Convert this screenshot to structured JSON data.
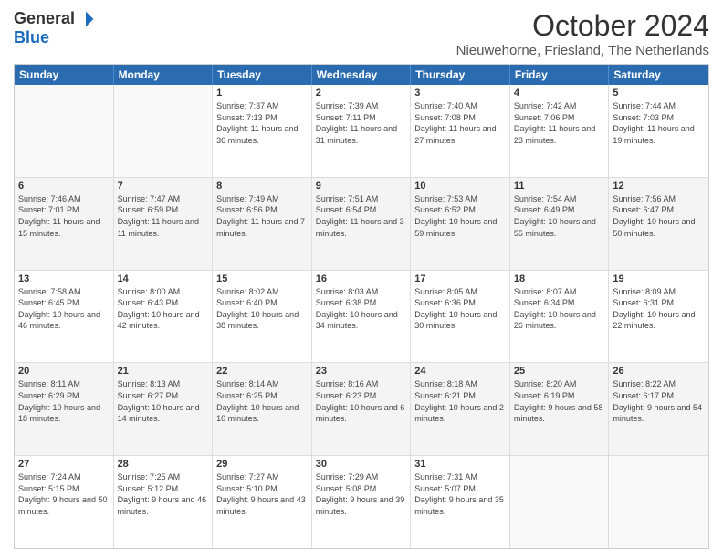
{
  "logo": {
    "general": "General",
    "blue": "Blue"
  },
  "title": "October 2024",
  "location": "Nieuwehorne, Friesland, The Netherlands",
  "days": [
    "Sunday",
    "Monday",
    "Tuesday",
    "Wednesday",
    "Thursday",
    "Friday",
    "Saturday"
  ],
  "weeks": [
    [
      {
        "date": "",
        "sunrise": "",
        "sunset": "",
        "daylight": ""
      },
      {
        "date": "",
        "sunrise": "",
        "sunset": "",
        "daylight": ""
      },
      {
        "date": "1",
        "sunrise": "Sunrise: 7:37 AM",
        "sunset": "Sunset: 7:13 PM",
        "daylight": "Daylight: 11 hours and 36 minutes."
      },
      {
        "date": "2",
        "sunrise": "Sunrise: 7:39 AM",
        "sunset": "Sunset: 7:11 PM",
        "daylight": "Daylight: 11 hours and 31 minutes."
      },
      {
        "date": "3",
        "sunrise": "Sunrise: 7:40 AM",
        "sunset": "Sunset: 7:08 PM",
        "daylight": "Daylight: 11 hours and 27 minutes."
      },
      {
        "date": "4",
        "sunrise": "Sunrise: 7:42 AM",
        "sunset": "Sunset: 7:06 PM",
        "daylight": "Daylight: 11 hours and 23 minutes."
      },
      {
        "date": "5",
        "sunrise": "Sunrise: 7:44 AM",
        "sunset": "Sunset: 7:03 PM",
        "daylight": "Daylight: 11 hours and 19 minutes."
      }
    ],
    [
      {
        "date": "6",
        "sunrise": "Sunrise: 7:46 AM",
        "sunset": "Sunset: 7:01 PM",
        "daylight": "Daylight: 11 hours and 15 minutes."
      },
      {
        "date": "7",
        "sunrise": "Sunrise: 7:47 AM",
        "sunset": "Sunset: 6:59 PM",
        "daylight": "Daylight: 11 hours and 11 minutes."
      },
      {
        "date": "8",
        "sunrise": "Sunrise: 7:49 AM",
        "sunset": "Sunset: 6:56 PM",
        "daylight": "Daylight: 11 hours and 7 minutes."
      },
      {
        "date": "9",
        "sunrise": "Sunrise: 7:51 AM",
        "sunset": "Sunset: 6:54 PM",
        "daylight": "Daylight: 11 hours and 3 minutes."
      },
      {
        "date": "10",
        "sunrise": "Sunrise: 7:53 AM",
        "sunset": "Sunset: 6:52 PM",
        "daylight": "Daylight: 10 hours and 59 minutes."
      },
      {
        "date": "11",
        "sunrise": "Sunrise: 7:54 AM",
        "sunset": "Sunset: 6:49 PM",
        "daylight": "Daylight: 10 hours and 55 minutes."
      },
      {
        "date": "12",
        "sunrise": "Sunrise: 7:56 AM",
        "sunset": "Sunset: 6:47 PM",
        "daylight": "Daylight: 10 hours and 50 minutes."
      }
    ],
    [
      {
        "date": "13",
        "sunrise": "Sunrise: 7:58 AM",
        "sunset": "Sunset: 6:45 PM",
        "daylight": "Daylight: 10 hours and 46 minutes."
      },
      {
        "date": "14",
        "sunrise": "Sunrise: 8:00 AM",
        "sunset": "Sunset: 6:43 PM",
        "daylight": "Daylight: 10 hours and 42 minutes."
      },
      {
        "date": "15",
        "sunrise": "Sunrise: 8:02 AM",
        "sunset": "Sunset: 6:40 PM",
        "daylight": "Daylight: 10 hours and 38 minutes."
      },
      {
        "date": "16",
        "sunrise": "Sunrise: 8:03 AM",
        "sunset": "Sunset: 6:38 PM",
        "daylight": "Daylight: 10 hours and 34 minutes."
      },
      {
        "date": "17",
        "sunrise": "Sunrise: 8:05 AM",
        "sunset": "Sunset: 6:36 PM",
        "daylight": "Daylight: 10 hours and 30 minutes."
      },
      {
        "date": "18",
        "sunrise": "Sunrise: 8:07 AM",
        "sunset": "Sunset: 6:34 PM",
        "daylight": "Daylight: 10 hours and 26 minutes."
      },
      {
        "date": "19",
        "sunrise": "Sunrise: 8:09 AM",
        "sunset": "Sunset: 6:31 PM",
        "daylight": "Daylight: 10 hours and 22 minutes."
      }
    ],
    [
      {
        "date": "20",
        "sunrise": "Sunrise: 8:11 AM",
        "sunset": "Sunset: 6:29 PM",
        "daylight": "Daylight: 10 hours and 18 minutes."
      },
      {
        "date": "21",
        "sunrise": "Sunrise: 8:13 AM",
        "sunset": "Sunset: 6:27 PM",
        "daylight": "Daylight: 10 hours and 14 minutes."
      },
      {
        "date": "22",
        "sunrise": "Sunrise: 8:14 AM",
        "sunset": "Sunset: 6:25 PM",
        "daylight": "Daylight: 10 hours and 10 minutes."
      },
      {
        "date": "23",
        "sunrise": "Sunrise: 8:16 AM",
        "sunset": "Sunset: 6:23 PM",
        "daylight": "Daylight: 10 hours and 6 minutes."
      },
      {
        "date": "24",
        "sunrise": "Sunrise: 8:18 AM",
        "sunset": "Sunset: 6:21 PM",
        "daylight": "Daylight: 10 hours and 2 minutes."
      },
      {
        "date": "25",
        "sunrise": "Sunrise: 8:20 AM",
        "sunset": "Sunset: 6:19 PM",
        "daylight": "Daylight: 9 hours and 58 minutes."
      },
      {
        "date": "26",
        "sunrise": "Sunrise: 8:22 AM",
        "sunset": "Sunset: 6:17 PM",
        "daylight": "Daylight: 9 hours and 54 minutes."
      }
    ],
    [
      {
        "date": "27",
        "sunrise": "Sunrise: 7:24 AM",
        "sunset": "Sunset: 5:15 PM",
        "daylight": "Daylight: 9 hours and 50 minutes."
      },
      {
        "date": "28",
        "sunrise": "Sunrise: 7:25 AM",
        "sunset": "Sunset: 5:12 PM",
        "daylight": "Daylight: 9 hours and 46 minutes."
      },
      {
        "date": "29",
        "sunrise": "Sunrise: 7:27 AM",
        "sunset": "Sunset: 5:10 PM",
        "daylight": "Daylight: 9 hours and 43 minutes."
      },
      {
        "date": "30",
        "sunrise": "Sunrise: 7:29 AM",
        "sunset": "Sunset: 5:08 PM",
        "daylight": "Daylight: 9 hours and 39 minutes."
      },
      {
        "date": "31",
        "sunrise": "Sunrise: 7:31 AM",
        "sunset": "Sunset: 5:07 PM",
        "daylight": "Daylight: 9 hours and 35 minutes."
      },
      {
        "date": "",
        "sunrise": "",
        "sunset": "",
        "daylight": ""
      },
      {
        "date": "",
        "sunrise": "",
        "sunset": "",
        "daylight": ""
      }
    ]
  ]
}
